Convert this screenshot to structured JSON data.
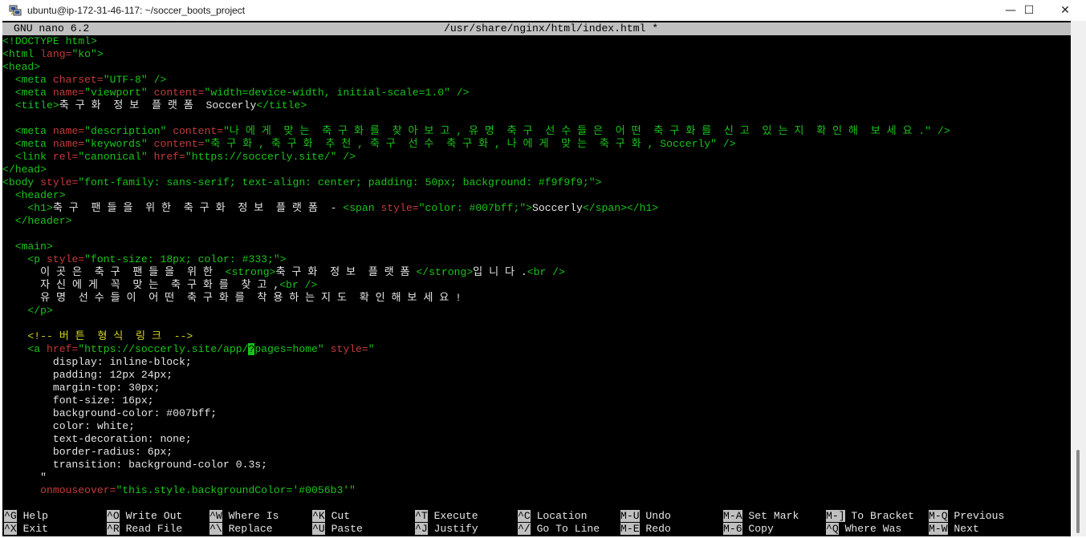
{
  "window": {
    "title": "ubuntu@ip-172-31-46-117: ~/soccer_boots_project",
    "icon": "putty-icon",
    "minimize_glyph": "—",
    "maximize_glyph": "☐",
    "close_glyph": "✕"
  },
  "nano": {
    "version": "GNU nano 6.2",
    "file": "/usr/share/nginx/html/index.html *"
  },
  "editor_lines": [
    [
      {
        "c": "g",
        "t": "<!DOCTYPE html>"
      }
    ],
    [
      {
        "c": "g",
        "t": "<html "
      },
      {
        "c": "r",
        "t": "lang="
      },
      {
        "c": "g",
        "t": "\"ko\">"
      }
    ],
    [
      {
        "c": "g",
        "t": "<head>"
      }
    ],
    [
      {
        "c": "g",
        "t": "  <meta "
      },
      {
        "c": "r",
        "t": "charset="
      },
      {
        "c": "g",
        "t": "\"UTF-8\" />"
      }
    ],
    [
      {
        "c": "g",
        "t": "  <meta "
      },
      {
        "c": "r",
        "t": "name="
      },
      {
        "c": "g",
        "t": "\"viewport\" "
      },
      {
        "c": "r",
        "t": "content="
      },
      {
        "c": "g",
        "t": "\"width=device-width, initial-scale=1.0\" />"
      }
    ],
    [
      {
        "c": "g",
        "t": "  <title>"
      },
      {
        "c": "w",
        "t": "축 구 화  정 보  플 랫 폼  Soccerly"
      },
      {
        "c": "g",
        "t": "</title>"
      }
    ],
    [],
    [
      {
        "c": "g",
        "t": "  <meta "
      },
      {
        "c": "r",
        "t": "name="
      },
      {
        "c": "g",
        "t": "\"description\" "
      },
      {
        "c": "r",
        "t": "content="
      },
      {
        "c": "g",
        "t": "\"나 에 게  맞 는  축 구 화 를  찾 아 보 고 , 유 명  축 구  선 수 들 은  어 떤  축 구 화 를  신 고  있 는 지  확 인 해  보 세 요 .\" />"
      }
    ],
    [
      {
        "c": "g",
        "t": "  <meta "
      },
      {
        "c": "r",
        "t": "name="
      },
      {
        "c": "g",
        "t": "\"keywords\" "
      },
      {
        "c": "r",
        "t": "content="
      },
      {
        "c": "g",
        "t": "\"축 구 화 , 축 구 화  추 천 , 축 구  선 수  축 구 화 , 나 에 게  맞 는  축 구 화 , Soccerly\" />"
      }
    ],
    [
      {
        "c": "g",
        "t": "  <link "
      },
      {
        "c": "r",
        "t": "rel="
      },
      {
        "c": "g",
        "t": "\"canonical\" "
      },
      {
        "c": "r",
        "t": "href="
      },
      {
        "c": "g",
        "t": "\"https://soccerly.site/\" />"
      }
    ],
    [
      {
        "c": "g",
        "t": "</head>"
      }
    ],
    [
      {
        "c": "g",
        "t": "<body "
      },
      {
        "c": "r",
        "t": "style="
      },
      {
        "c": "g",
        "t": "\"font-family: sans-serif; text-align: center; padding: 50px; background: #f9f9f9;\">"
      }
    ],
    [
      {
        "c": "g",
        "t": "  <header>"
      }
    ],
    [
      {
        "c": "g",
        "t": "    <h1>"
      },
      {
        "c": "w",
        "t": "축 구  팬 들 을  위 한  축 구 화  정 보  플 랫 폼  - "
      },
      {
        "c": "g",
        "t": "<span "
      },
      {
        "c": "r",
        "t": "style="
      },
      {
        "c": "g",
        "t": "\"color: #007bff;\">"
      },
      {
        "c": "w",
        "t": "Soccerly"
      },
      {
        "c": "g",
        "t": "</span></h1>"
      }
    ],
    [
      {
        "c": "g",
        "t": "  </header>"
      }
    ],
    [],
    [
      {
        "c": "g",
        "t": "  <main>"
      }
    ],
    [
      {
        "c": "g",
        "t": "    <p "
      },
      {
        "c": "r",
        "t": "style="
      },
      {
        "c": "g",
        "t": "\"font-size: 18px; color: #333;\">"
      }
    ],
    [
      {
        "c": "w",
        "t": "      이 곳 은  축 구  팬 들 을  위 한  "
      },
      {
        "c": "g",
        "t": "<strong>"
      },
      {
        "c": "w",
        "t": "축 구 화  정 보  플 랫 폼 "
      },
      {
        "c": "g",
        "t": "</strong>"
      },
      {
        "c": "w",
        "t": "입 니 다 ."
      },
      {
        "c": "g",
        "t": "<br />"
      }
    ],
    [
      {
        "c": "w",
        "t": "      자 신 에 게  꼭  맞 는  축 구 화 를  찾 고 ,"
      },
      {
        "c": "g",
        "t": "<br />"
      }
    ],
    [
      {
        "c": "w",
        "t": "      유 명  선 수 들 이  어 떤  축 구 화 를  착 용 하 는 지 도  확 인 해 보 세 요 !"
      }
    ],
    [
      {
        "c": "g",
        "t": "    </p>"
      }
    ],
    [],
    [
      {
        "c": "y",
        "t": "    <!-- 버 튼  형 식  링 크  -->"
      }
    ],
    [
      {
        "c": "g",
        "t": "    <a "
      },
      {
        "c": "r",
        "t": "href="
      },
      {
        "c": "g",
        "t": "\"https://soccerly.site/app/"
      },
      {
        "c": "cursor",
        "t": "?"
      },
      {
        "c": "g",
        "t": "pages=home\" "
      },
      {
        "c": "r",
        "t": "style="
      },
      {
        "c": "g",
        "t": "\""
      }
    ],
    [
      {
        "c": "w",
        "t": "        display: inline-block;"
      }
    ],
    [
      {
        "c": "w",
        "t": "        padding: 12px 24px;"
      }
    ],
    [
      {
        "c": "w",
        "t": "        margin-top: 30px;"
      }
    ],
    [
      {
        "c": "w",
        "t": "        font-size: 16px;"
      }
    ],
    [
      {
        "c": "w",
        "t": "        background-color: #007bff;"
      }
    ],
    [
      {
        "c": "w",
        "t": "        color: white;"
      }
    ],
    [
      {
        "c": "w",
        "t": "        text-decoration: none;"
      }
    ],
    [
      {
        "c": "w",
        "t": "        border-radius: 6px;"
      }
    ],
    [
      {
        "c": "w",
        "t": "        transition: background-color 0.3s;"
      }
    ],
    [
      {
        "c": "w",
        "t": "      \""
      }
    ],
    [
      {
        "c": "r",
        "t": "      onmouseover="
      },
      {
        "c": "g",
        "t": "\"this.style.backgroundColor='#0056b3'\""
      }
    ]
  ],
  "shortcuts": [
    {
      "key": "^G",
      "label": "Help"
    },
    {
      "key": "^X",
      "label": "Exit"
    },
    {
      "key": "^O",
      "label": "Write Out"
    },
    {
      "key": "^R",
      "label": "Read File"
    },
    {
      "key": "^W",
      "label": "Where Is"
    },
    {
      "key": "^\\",
      "label": "Replace"
    },
    {
      "key": "^K",
      "label": "Cut"
    },
    {
      "key": "^U",
      "label": "Paste"
    },
    {
      "key": "^T",
      "label": "Execute"
    },
    {
      "key": "^J",
      "label": "Justify"
    },
    {
      "key": "^C",
      "label": "Location"
    },
    {
      "key": "^/",
      "label": "Go To Line"
    },
    {
      "key": "M-U",
      "label": "Undo"
    },
    {
      "key": "M-E",
      "label": "Redo"
    },
    {
      "key": "M-A",
      "label": "Set Mark"
    },
    {
      "key": "M-6",
      "label": "Copy"
    },
    {
      "key": "M-]",
      "label": "To Bracket"
    },
    {
      "key": "^Q",
      "label": "Where Was"
    },
    {
      "key": "M-Q",
      "label": "Previous"
    },
    {
      "key": "M-W",
      "label": "Next"
    }
  ]
}
